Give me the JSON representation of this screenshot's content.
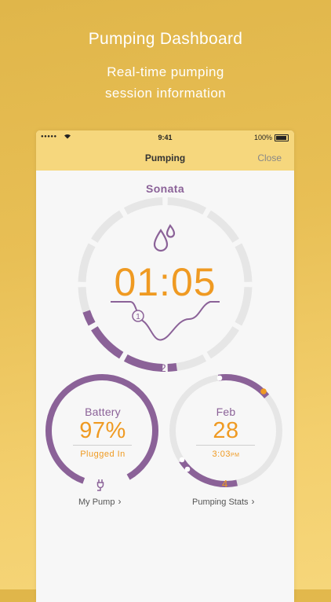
{
  "promo": {
    "title": "Pumping Dashboard",
    "subtitle_line1": "Real-time pumping",
    "subtitle_line2": "session information"
  },
  "status_bar": {
    "signal": "●●●●●",
    "time": "9:41",
    "battery_percent": "100%"
  },
  "nav": {
    "title": "Pumping",
    "close_label": "Close"
  },
  "session": {
    "device_name": "Sonata",
    "timer": "01:05",
    "current_phase_marker": "1",
    "phase_count": "2",
    "progress_fraction": 0.22
  },
  "battery_card": {
    "label": "Battery",
    "value": "97%",
    "status": "Plugged In",
    "link_label": "My Pump",
    "level_fraction": 0.97
  },
  "stats_card": {
    "label": "Feb",
    "value": "28",
    "time": "3:03",
    "time_suffix": "PM",
    "session_count": "4",
    "link_label": "Pumping Stats"
  },
  "colors": {
    "accent_orange": "#ef9a22",
    "accent_purple": "#8b6298",
    "nav_yellow": "#f6d77d",
    "ring_gray": "#e6e6e6"
  }
}
